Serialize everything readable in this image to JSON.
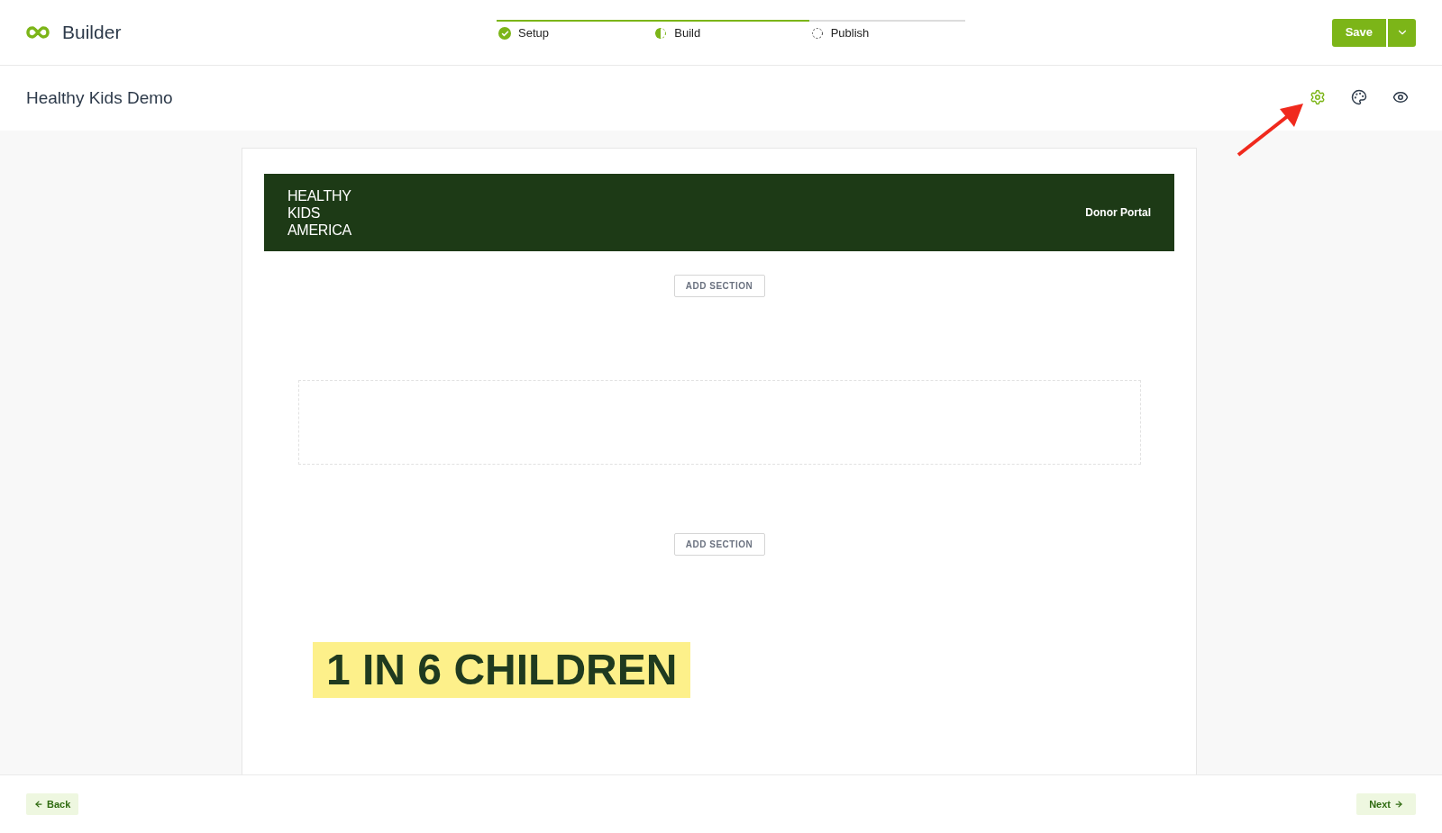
{
  "app": {
    "title": "Builder"
  },
  "steps": [
    {
      "label": "Setup",
      "kind": "complete"
    },
    {
      "label": "Build",
      "kind": "current"
    },
    {
      "label": "Publish",
      "kind": "pending"
    }
  ],
  "save_button": {
    "label": "Save"
  },
  "page": {
    "title": "Healthy Kids Demo"
  },
  "tools": [
    {
      "kind": "settings",
      "selected": true
    },
    {
      "kind": "palette",
      "selected": false
    },
    {
      "kind": "preview",
      "selected": false
    }
  ],
  "banner": {
    "logo_lines": [
      "HEALTHY",
      "KIDS",
      "AMERICA"
    ],
    "link": "Donor Portal"
  },
  "sections": [
    {
      "kind": "add",
      "label": "ADD SECTION"
    },
    {
      "kind": "empty"
    },
    {
      "kind": "add",
      "label": "ADD SECTION"
    },
    {
      "kind": "headline",
      "text": "1 IN 6 CHILDREN"
    }
  ],
  "footer": {
    "back": "Back",
    "next": "Next"
  }
}
